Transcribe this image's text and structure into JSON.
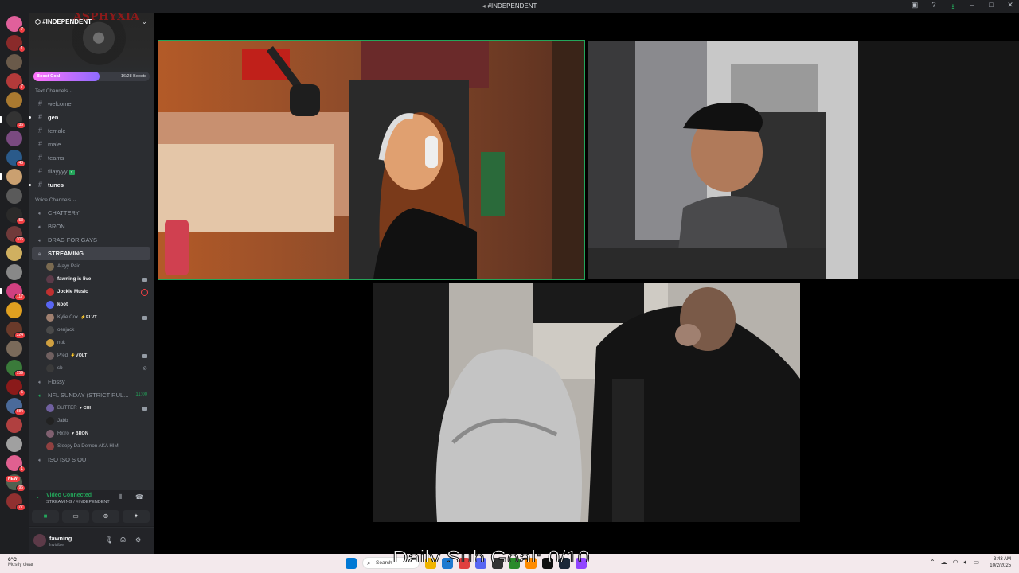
{
  "window": {
    "title": "#INDEPENDENT"
  },
  "servers": [
    {
      "badge": "7",
      "color": "#e0609b"
    },
    {
      "badge": "1",
      "color": "#8a2a2a"
    },
    {
      "badge": "",
      "color": "#6a5a4a"
    },
    {
      "badge": "7",
      "color": "#b33a3a"
    },
    {
      "badge": "",
      "color": "#aa7a30"
    },
    {
      "badge": "36",
      "color": "#333333"
    },
    {
      "badge": "",
      "color": "#7a4a80"
    },
    {
      "badge": "48",
      "color": "#2a5a8a"
    },
    {
      "badge": "",
      "color": "#caa070"
    },
    {
      "badge": "",
      "color": "#5a5a5a"
    },
    {
      "badge": "53",
      "color": "#2a2a2a"
    },
    {
      "badge": "106",
      "color": "#703a3a"
    },
    {
      "badge": "",
      "color": "#d0b060"
    },
    {
      "badge": "",
      "color": "#888888"
    },
    {
      "badge": "117",
      "color": "#d04080"
    },
    {
      "badge": "",
      "color": "#e0a020"
    },
    {
      "badge": "324",
      "color": "#6a3a2a"
    },
    {
      "badge": "",
      "color": "#7a6a5a"
    },
    {
      "badge": "159",
      "color": "#3a7a3a"
    },
    {
      "badge": "5",
      "color": "#8a1a1a"
    },
    {
      "badge": "684",
      "color": "#4a6a9a"
    },
    {
      "badge": "",
      "color": "#b04040"
    },
    {
      "badge": "",
      "color": "#a0a0a0"
    },
    {
      "badge": "1",
      "color": "#e06090"
    },
    {
      "badge": "96",
      "color": "#506050"
    },
    {
      "badge": "77",
      "color": "#903030"
    }
  ],
  "rail_new": "NEW",
  "server": {
    "name": "#INDEPENDENT",
    "brand": "ASPHYXIA",
    "boost_goal_label": "Boost Goal",
    "boost_count": "16/28 Boosts",
    "boost_progress": 0.57
  },
  "text_category": "Text Channels",
  "text_channels": [
    {
      "name": "welcome",
      "style": ""
    },
    {
      "name": "gen",
      "style": "bold"
    },
    {
      "name": "female",
      "style": ""
    },
    {
      "name": "male",
      "style": ""
    },
    {
      "name": "teams",
      "style": ""
    },
    {
      "name": "fllayyyy",
      "style": "check"
    },
    {
      "name": "tunes",
      "style": "bold"
    }
  ],
  "voice_category": "Voice Channels",
  "voice_channels_top": [
    "CHATTERY",
    "BRON",
    "DRAG FOR GAYS"
  ],
  "streaming_channel": "STREAMING",
  "streaming_users": [
    {
      "name": "Ajayy Paid",
      "bold": false,
      "tag": "",
      "icon": "",
      "color": "#7a6a50"
    },
    {
      "name": "fawning is live",
      "bold": true,
      "tag": "",
      "icon": "cam",
      "color": "#5c3a48"
    },
    {
      "name": "Jockie Music",
      "bold": true,
      "tag": "",
      "icon": "live",
      "color": "#c03030"
    },
    {
      "name": "koot",
      "bold": true,
      "tag": "",
      "icon": "",
      "color": "#5865f2"
    },
    {
      "name": "Kylie Cox",
      "bold": false,
      "tag": "⚡ELVT",
      "icon": "cam",
      "color": "#a08070"
    },
    {
      "name": "oenjack",
      "bold": false,
      "tag": "",
      "icon": "",
      "color": "#4a4a4a"
    },
    {
      "name": "nuk",
      "bold": false,
      "tag": "",
      "icon": "",
      "color": "#d0a040"
    },
    {
      "name": "Pred",
      "bold": false,
      "tag": "⚡VOLT",
      "icon": "cam",
      "color": "#706060"
    },
    {
      "name": "sb",
      "bold": false,
      "tag": "",
      "icon": "mute",
      "color": "#3a3a3a"
    }
  ],
  "voice_channels_mid": [
    "Flossy"
  ],
  "nfl_channel": {
    "name": "NFL SUNDAY (STRICT RUL...",
    "timer": "11:00"
  },
  "nfl_users": [
    {
      "name": "BUTTER",
      "tag": "♥ CHI",
      "icon": "cam",
      "color": "#7060a0"
    },
    {
      "name": "Jabb",
      "tag": "",
      "icon": "",
      "color": "#222222"
    },
    {
      "name": "Rxtro",
      "tag": "♥ BRON",
      "icon": "",
      "color": "#806070"
    },
    {
      "name": "Sleepy Da Demon AKA HIM",
      "tag": "",
      "icon": "",
      "color": "#904040"
    }
  ],
  "voice_channels_bottom": [
    "ISO ISO S OUT"
  ],
  "voice_status": {
    "title": "Video Connected",
    "sub": "STREAMING / #INDEPENDENT"
  },
  "user": {
    "name": "fawning",
    "status": "Invisible"
  },
  "taskbar": {
    "temp": "6°C",
    "weather": "Mostly clear",
    "search": "Search",
    "time": "3:43 AM",
    "date": "10/2/2025"
  },
  "overlay_text": "Daily Sub Goal: 0/10"
}
